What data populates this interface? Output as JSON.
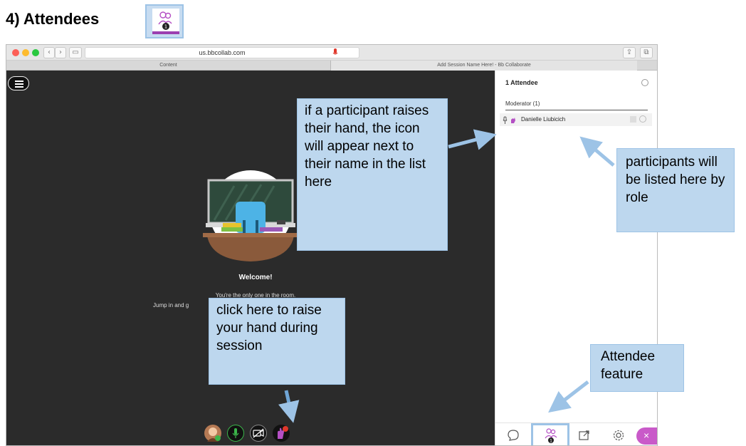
{
  "doc": {
    "heading": "4) Attendees"
  },
  "browser": {
    "url": "us.bbcollab.com",
    "tabs": [
      "Content",
      "Add Session Name Here! - Bb Collaborate"
    ]
  },
  "stage": {
    "welcome_title": "Welcome!",
    "welcome_line1": "You're the only one in the room.",
    "welcome_line2": "Jump in and g"
  },
  "panel": {
    "title": "1 Attendee",
    "section": "Moderator (1)",
    "attendee_name": "Danielle Liubicich",
    "close_label": "×"
  },
  "callouts": {
    "hand": "if a participant raises their hand, the icon will appear next to their name in the list here",
    "role": "participants will be listed here by role",
    "raise": "click here to raise your hand during session",
    "feature": "Attendee feature"
  },
  "colors": {
    "accent": "#c95ac9",
    "callout_fill": "#bdd7ee",
    "arrow": "#9dc3e6",
    "stage_bg": "#2b2b2b"
  },
  "icons": [
    "attendees-icon",
    "menu-icon",
    "mic-icon",
    "camera-off-icon",
    "hand-raise-icon",
    "chat-icon",
    "share-icon",
    "settings-icon",
    "close-icon"
  ]
}
